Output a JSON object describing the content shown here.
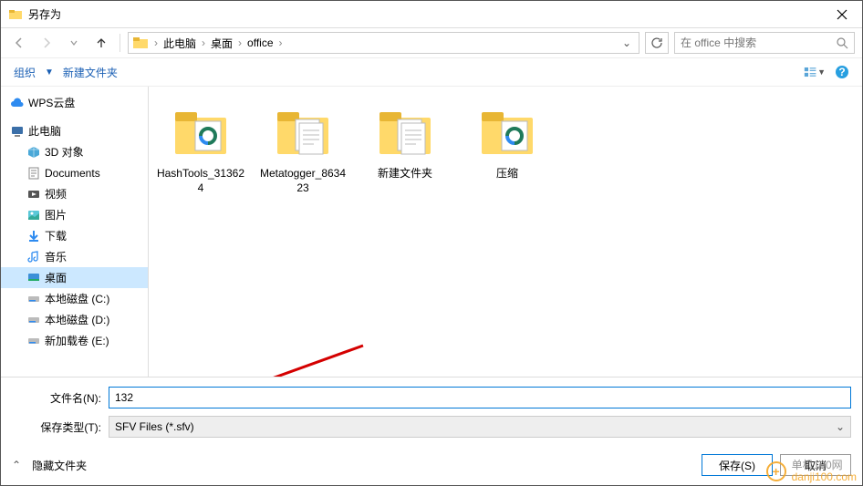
{
  "titlebar": {
    "title": "另存为"
  },
  "nav": {
    "breadcrumbs": [
      "此电脑",
      "桌面",
      "office"
    ],
    "search_placeholder": "在 office 中搜索"
  },
  "toolbar": {
    "organize": "组织",
    "new_folder": "新建文件夹"
  },
  "sidebar": {
    "items": [
      {
        "label": "WPS云盘",
        "icon": "cloud"
      },
      {
        "label": "此电脑",
        "icon": "pc"
      },
      {
        "label": "3D 对象",
        "icon": "3d"
      },
      {
        "label": "Documents",
        "icon": "docs"
      },
      {
        "label": "视频",
        "icon": "video"
      },
      {
        "label": "图片",
        "icon": "pictures"
      },
      {
        "label": "下载",
        "icon": "downloads"
      },
      {
        "label": "音乐",
        "icon": "music"
      },
      {
        "label": "桌面",
        "icon": "desktop"
      },
      {
        "label": "本地磁盘 (C:)",
        "icon": "disk"
      },
      {
        "label": "本地磁盘 (D:)",
        "icon": "disk"
      },
      {
        "label": "新加载卷 (E:)",
        "icon": "disk"
      }
    ]
  },
  "files": [
    {
      "label": "HashTools_313624",
      "type": "folder-edge"
    },
    {
      "label": "Metatogger_863423",
      "type": "folder-docs"
    },
    {
      "label": "新建文件夹",
      "type": "folder-docs"
    },
    {
      "label": "压缩",
      "type": "folder-edge"
    }
  ],
  "form": {
    "filename_label": "文件名(N):",
    "filename_value": "132",
    "filetype_label": "保存类型(T):",
    "filetype_value": "SFV Files (*.sfv)"
  },
  "footer": {
    "hide_folders": "隐藏文件夹",
    "save": "保存(S)",
    "cancel": "取消"
  },
  "watermark": {
    "cn": "单机100网",
    "en": "danji100.com"
  }
}
